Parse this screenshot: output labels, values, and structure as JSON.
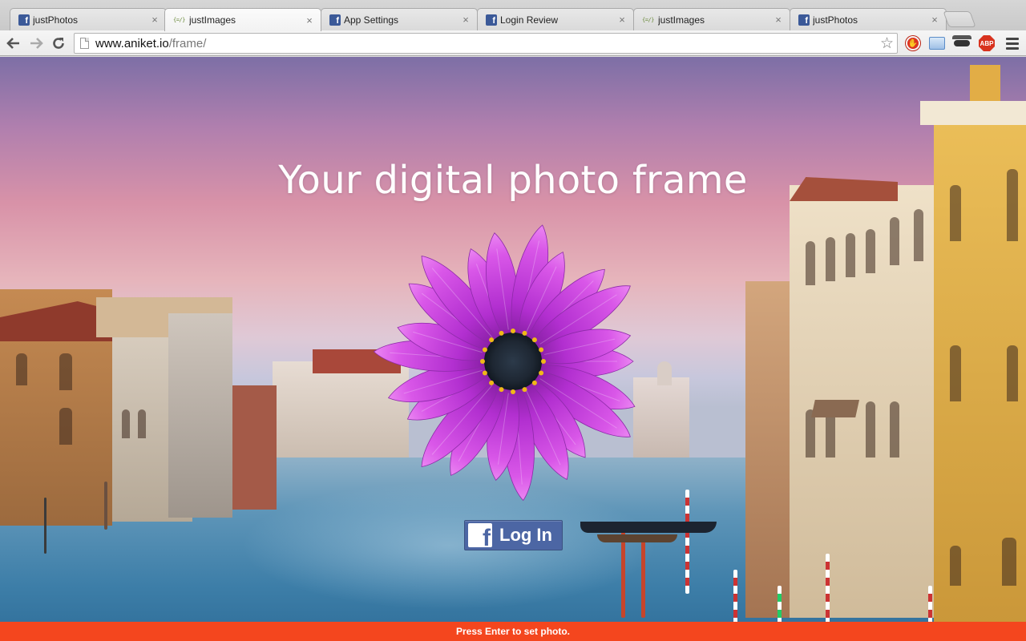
{
  "browser": {
    "tabs": [
      {
        "title": "justPhotos",
        "icon": "facebook-icon",
        "active": false
      },
      {
        "title": "justImages",
        "icon": "code-icon",
        "active": true
      },
      {
        "title": "App Settings",
        "icon": "facebook-icon",
        "active": false
      },
      {
        "title": "Login Review",
        "icon": "facebook-icon",
        "active": false
      },
      {
        "title": "justImages",
        "icon": "code-icon",
        "active": false
      },
      {
        "title": "justPhotos",
        "icon": "facebook-icon",
        "active": false
      }
    ],
    "tab_close_glyph": "×",
    "favicon_code_text": "{=/}",
    "favicon_fb_text": "f",
    "url_host": "www.aniket.io",
    "url_path": "/frame/",
    "abp_label": "ABP"
  },
  "page": {
    "headline": "Your digital photo frame",
    "login_button": {
      "icon_text": "f",
      "label": "Log In"
    },
    "status_text": "Press Enter to set photo.",
    "colors": {
      "status_bar": "#f4461e",
      "facebook_blue": "#4c66a4",
      "flower": "#c83ad6"
    }
  }
}
